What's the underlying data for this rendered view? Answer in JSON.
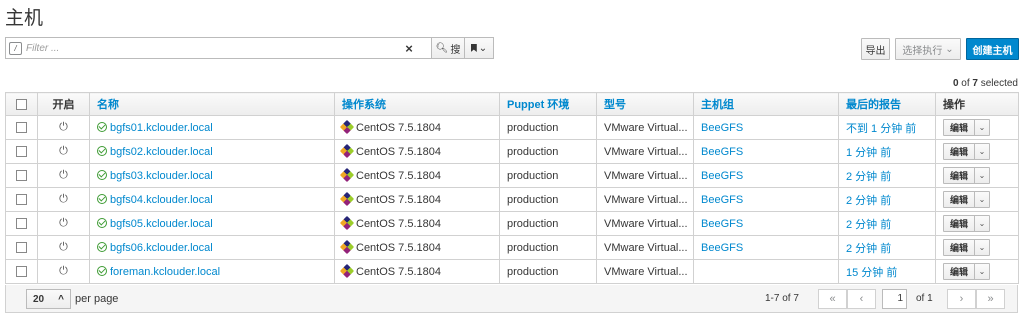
{
  "page_title": "主机",
  "search": {
    "filter_icon": "/",
    "placeholder": "Filter ...",
    "clear_icon": "×",
    "search_label": "搜",
    "search_icon": "magnifier-icon",
    "bookmark_caret": "⌄"
  },
  "actions": {
    "export_label": "导出",
    "select_action_label": "选择执行",
    "select_action_caret": "⌄",
    "create_label": "创建主机"
  },
  "selection": {
    "selected": "0",
    "of_text": " of ",
    "total": "7",
    "suffix": " selected"
  },
  "table": {
    "columns": {
      "power": "开启",
      "name": "名称",
      "os": "操作系统",
      "env": "Puppet 环境",
      "model": "型号",
      "hostgroup": "主机组",
      "last_report": "最后的报告",
      "actions": "操作"
    },
    "rows": [
      {
        "name": "bgfs01.kclouder.local",
        "os": "CentOS 7.5.1804",
        "env": "production",
        "model": "VMware Virtual...",
        "hostgroup": "BeeGFS",
        "last_report": "不到 1 分钟 前",
        "edit": "编辑"
      },
      {
        "name": "bgfs02.kclouder.local",
        "os": "CentOS 7.5.1804",
        "env": "production",
        "model": "VMware Virtual...",
        "hostgroup": "BeeGFS",
        "last_report": "1 分钟 前",
        "edit": "编辑"
      },
      {
        "name": "bgfs03.kclouder.local",
        "os": "CentOS 7.5.1804",
        "env": "production",
        "model": "VMware Virtual...",
        "hostgroup": "BeeGFS",
        "last_report": "2 分钟 前",
        "edit": "编辑"
      },
      {
        "name": "bgfs04.kclouder.local",
        "os": "CentOS 7.5.1804",
        "env": "production",
        "model": "VMware Virtual...",
        "hostgroup": "BeeGFS",
        "last_report": "2 分钟 前",
        "edit": "编辑"
      },
      {
        "name": "bgfs05.kclouder.local",
        "os": "CentOS 7.5.1804",
        "env": "production",
        "model": "VMware Virtual...",
        "hostgroup": "BeeGFS",
        "last_report": "2 分钟 前",
        "edit": "编辑"
      },
      {
        "name": "bgfs06.kclouder.local",
        "os": "CentOS 7.5.1804",
        "env": "production",
        "model": "VMware Virtual...",
        "hostgroup": "BeeGFS",
        "last_report": "2 分钟 前",
        "edit": "编辑"
      },
      {
        "name": "foreman.kclouder.local",
        "os": "CentOS 7.5.1804",
        "env": "production",
        "model": "VMware Virtual...",
        "hostgroup": "",
        "last_report": "15 分钟 前",
        "edit": "编辑"
      }
    ]
  },
  "pagination": {
    "per_page_value": "20",
    "per_page_caret": "^",
    "per_page_label": "per page",
    "range": "1-7 of  7",
    "first": "«",
    "prev": "‹",
    "current_page": "1",
    "of_pages": "of  1",
    "next": "›",
    "last": "»"
  },
  "colors": {
    "link": "#0088ce",
    "ok": "#3f9c35",
    "primary": "#0088ce"
  }
}
